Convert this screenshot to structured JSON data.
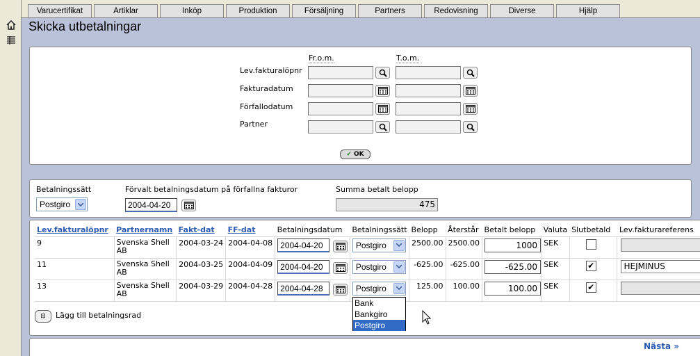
{
  "tabs": [
    "Varucertifikat",
    "Artiklar",
    "Inköp",
    "Produktion",
    "Försäljning",
    "Partners",
    "Redovisning",
    "Diverse",
    "Hjälp"
  ],
  "page_title": "Skicka utbetalningar",
  "filter": {
    "from_header": "Fr.o.m.",
    "to_header": "T.o.m.",
    "rows": [
      "Lev.fakturalöpnr",
      "Fakturadatum",
      "Förfallodatum",
      "Partner"
    ],
    "ok_label": "OK"
  },
  "payment": {
    "method_label": "Betalningssätt",
    "method_value": "Postgiro",
    "default_date_label": "Förvalt betalningsdatum på förfallna fakturor",
    "default_date_value": "2004-04-20",
    "sum_label": "Summa betalt belopp",
    "sum_value": "475"
  },
  "table": {
    "headers": [
      "Lev.fakturalöpnr",
      "Partnernamn",
      "Fakt-dat",
      "FF-dat",
      "Betalningsdatum",
      "Betalningssätt",
      "Belopp",
      "Återstår",
      "Betalt belopp",
      "Valuta",
      "Slutbetald",
      "Lev.fakturareferens"
    ],
    "rows": [
      {
        "nr": "9",
        "partner": "Svenska Shell AB",
        "fakt": "2004-03-24",
        "ff": "2004-04-08",
        "betdat": "2004-04-20",
        "betsatt": "Postgiro",
        "belopp": "2500.00",
        "aterstar": "2500.00",
        "betalt": "1000",
        "valuta": "SEK",
        "slutbetald": false,
        "ref": ""
      },
      {
        "nr": "11",
        "partner": "Svenska Shell AB",
        "fakt": "2004-03-25",
        "ff": "2004-04-09",
        "betdat": "2004-04-20",
        "betsatt": "Postgiro",
        "belopp": "-625.00",
        "aterstar": "-625.00",
        "betalt": "-625.00",
        "valuta": "SEK",
        "slutbetald": true,
        "ref": "HEJMINUS"
      },
      {
        "nr": "13",
        "partner": "Svenska Shell AB",
        "fakt": "2004-03-29",
        "ff": "2004-04-28",
        "betdat": "2004-04-28",
        "betsatt": "Postgiro",
        "belopp": "125.00",
        "aterstar": "100.00",
        "betalt": "100.00",
        "valuta": "SEK",
        "slutbetald": true,
        "ref": ""
      }
    ]
  },
  "dropdown_options": [
    "Bank",
    "Bankgiro",
    "Postgiro"
  ],
  "add_row_label": "Lägg till betalningsrad",
  "next_label": "Nästa »"
}
